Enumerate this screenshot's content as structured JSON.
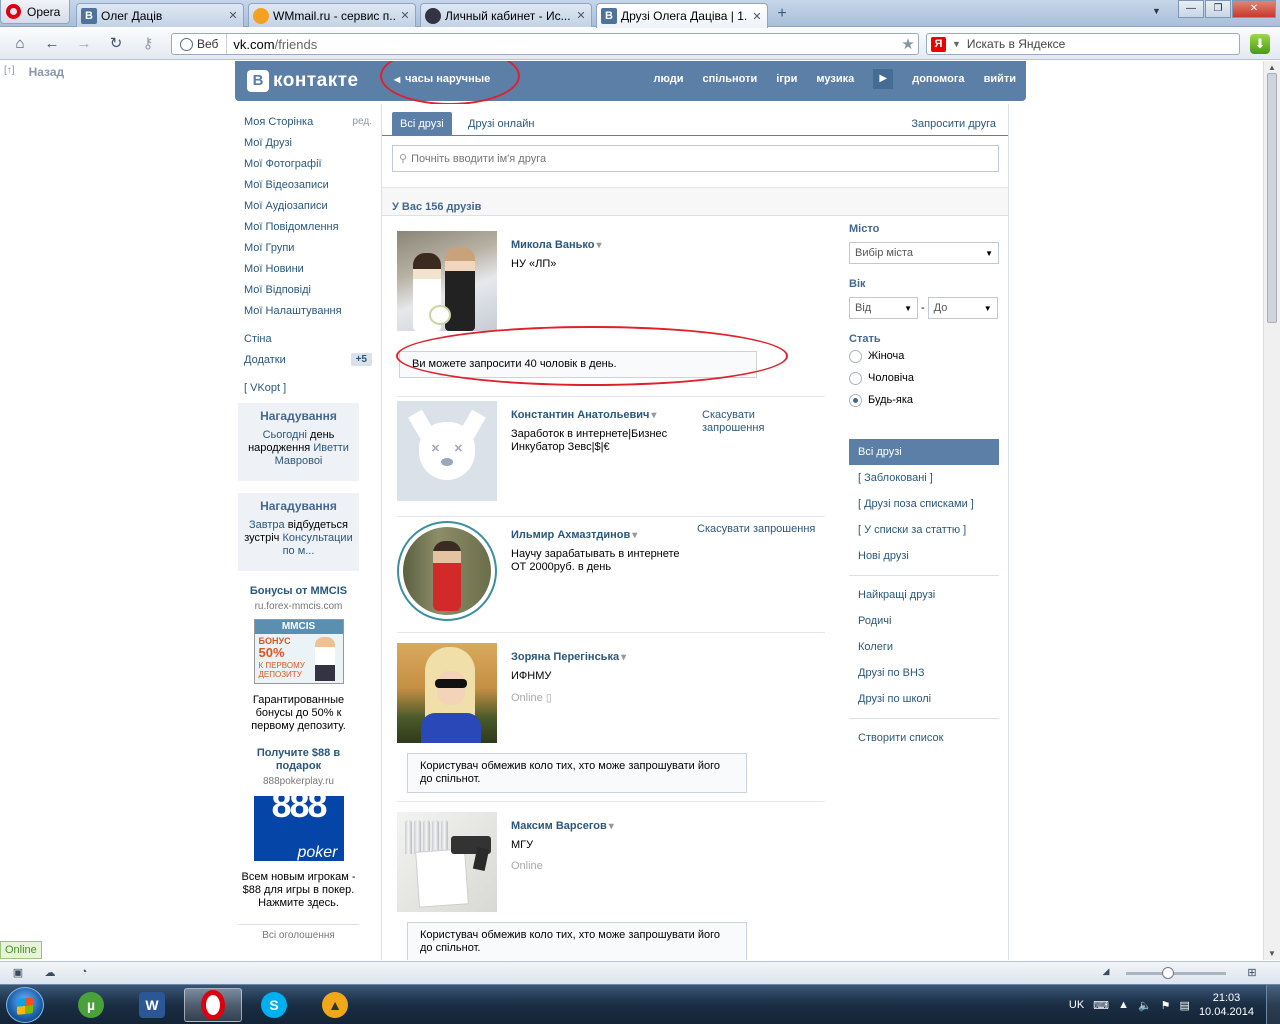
{
  "browser": {
    "app_name": "Opera",
    "tabs": [
      {
        "label": "Олег Даців",
        "icon": "vk-icon"
      },
      {
        "label": "WMmail.ru - сервис п...",
        "icon": "wmmail-icon"
      },
      {
        "label": "Личный кабинет - Ис...",
        "icon": "cabinet-icon"
      },
      {
        "label": "Друзі Олега Даціва | 1...",
        "icon": "vk-icon",
        "active": true
      }
    ],
    "address_prefix": "Веб",
    "url_host": "vk.com",
    "url_path": "/friends",
    "search_placeholder": "Искать в Яндексе",
    "search_engine_letter": "Я"
  },
  "page": {
    "back_up": "[↑]",
    "back_label": "Назад",
    "header": {
      "logo_letter": "В",
      "logo_text": "контакте",
      "status": "часы наручные",
      "nav": [
        "люди",
        "спільноти",
        "ігри",
        "музика",
        "допомога",
        "вийти"
      ]
    },
    "left_menu": {
      "items": [
        "Моя Сторінка",
        "Мої Друзі",
        "Мої Фотографії",
        "Мої Відеозаписи",
        "Мої Аудіозаписи",
        "Мої Повідомлення",
        "Мої Групи",
        "Мої Новини",
        "Мої Відповіді",
        "Мої Налаштування"
      ],
      "edit_label": "ред.",
      "wall": "Стіна",
      "apps": "Додатки",
      "apps_badge": "+5",
      "vkopt": "[ VKopt ]"
    },
    "reminders": [
      {
        "title": "Нагадування",
        "link1": "Сьогодні",
        "text1": "день народження",
        "link2": "Иветти Мавровоі"
      },
      {
        "title": "Нагадування",
        "link1": "Завтра",
        "text1": "відбудеться зустріч",
        "link2": "Консультации по м..."
      }
    ],
    "ads": [
      {
        "title": "Бонусы от MMCIS",
        "domain": "ru.forex-mmcis.com",
        "img_logo": "MMCIS",
        "img_line1": "БОНУС",
        "img_line2": "50%",
        "img_line3": "К ПЕРВОМУ ДЕПОЗИТУ",
        "text": "Гарантированные бонусы до 50% к первому депозиту."
      },
      {
        "title": "Получите $88 в подарок",
        "domain": "888pokerplay.ru",
        "img_num": "888",
        "img_word": "poker",
        "text": "Всем новым игрокам - $88 для игры в покер. Нажмите здесь."
      }
    ],
    "ads_more": "Всі оголошення",
    "online_badge": "Online"
  },
  "friends": {
    "tab_all": "Всі друзі",
    "tab_online": "Друзі онлайн",
    "invite": "Запросити друга",
    "search_placeholder": "Почніть вводити ім'я друга",
    "count": "У Вас 156 друзів",
    "invite_notice": "Ви можете запросити 40 чоловік в день.",
    "list": [
      {
        "name": "Микола Ванько",
        "sub": "НУ «ЛП»"
      },
      {
        "name": "Константин Анатольевич",
        "sub": "Заработок в интернете|Бизнес Инкубатор Зевс|$|€",
        "action": "Скасувати запрошення"
      },
      {
        "name": "Ильмир Ахмазтдинов",
        "sub": "Научу зарабатывать в интернете ОТ 2000руб. в день",
        "action": "Скасувати запрошення"
      },
      {
        "name": "Зоряна Перегінська",
        "sub": "ИФНМУ",
        "online": "Online",
        "note": "Користувач обмежив коло тих, хто може запрошувати його до спільнот."
      },
      {
        "name": "Максим Варсегов",
        "sub": "МГУ",
        "online": "Online",
        "note": "Користувач обмежив коло тих, хто може запрошувати його до спільнот."
      }
    ]
  },
  "filters": {
    "city_label": "Місто",
    "city_value": "Вибір міста",
    "age_label": "Вік",
    "age_from": "Від",
    "age_dash": "-",
    "age_to": "До",
    "sex_label": "Стать",
    "sex_options": [
      "Жіноча",
      "Чоловіча",
      "Будь-яка"
    ],
    "sex_selected": 2,
    "lists": [
      "Всі друзі",
      "[ Заблоковані ]",
      "[ Друзі поза списками ]",
      "[ У списки за статтю ]",
      "Нові друзі"
    ],
    "lists2": [
      "Найкращі друзі",
      "Родичі",
      "Колеги",
      "Друзі по ВНЗ",
      "Друзі по школі"
    ],
    "create": "Створити список"
  },
  "taskbar": {
    "lang": "UK",
    "time": "21:03",
    "date": "10.04.2014"
  },
  "colors": {
    "vk_header": "#5b7fa6",
    "vk_link": "#2b587a",
    "annotation": "#e0202a"
  }
}
